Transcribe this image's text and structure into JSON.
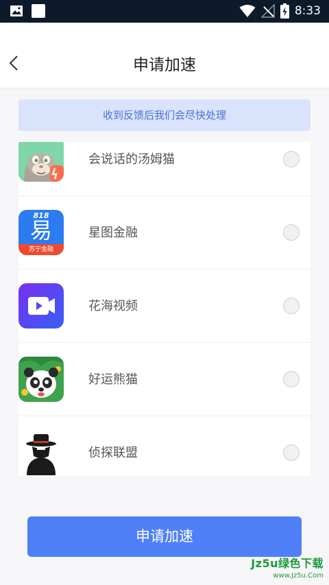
{
  "status_bar": {
    "time": "8:33"
  },
  "header": {
    "title": "申请加速"
  },
  "notice": {
    "text": "收到反馈后我们会尽快处理"
  },
  "apps": [
    {
      "name": "会说话的汤姆猫",
      "icon": "tom-cat-app-icon",
      "selected": false
    },
    {
      "name": "星图金融",
      "icon": "xingtu-finance-app-icon",
      "selected": false,
      "icon_text_top": "818",
      "icon_text_main": "易",
      "icon_text_bottom": "苏宁金融"
    },
    {
      "name": "花海视频",
      "icon": "huahai-video-app-icon",
      "selected": false
    },
    {
      "name": "好运熊猫",
      "icon": "lucky-panda-app-icon",
      "selected": false
    },
    {
      "name": "侦探联盟",
      "icon": "detective-league-app-icon",
      "selected": false
    }
  ],
  "submit": {
    "label": "申请加速"
  },
  "watermark": {
    "main": "Jz5u绿色下载",
    "sub": "www.Jz5u.Com"
  },
  "colors": {
    "accent": "#4f80f7",
    "notice_bg": "#d9e3fb",
    "notice_text": "#4a72d8"
  }
}
